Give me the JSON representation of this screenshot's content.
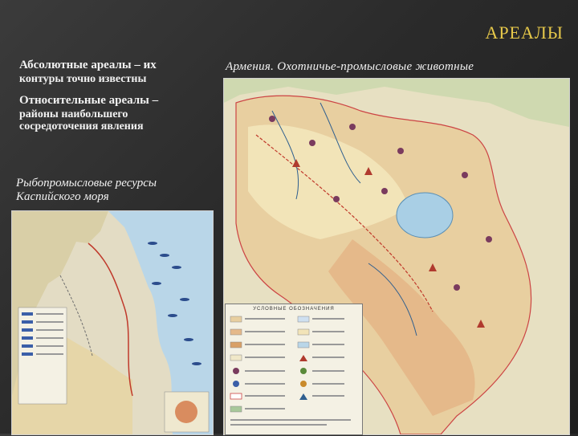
{
  "slide": {
    "title": "АРЕАЛЫ",
    "absolute_heading": "Абсолютные ареалы – их",
    "absolute_sub": "контуры точно известны",
    "relative_heading": "Относительные ареалы –",
    "relative_sub": "районы наибольшего сосредоточения явления",
    "caspian_caption": "Рыбопромысловые ресурсы Каспийского моря",
    "armenia_caption": "Армения. Охотничье-промысловые животные"
  },
  "legend": {
    "title": "УСЛОВНЫЕ ОБОЗНАЧЕНИЯ"
  },
  "colors": {
    "title": "#e6c84a",
    "background": "#2e2e2e",
    "text": "#f2f2f2"
  }
}
